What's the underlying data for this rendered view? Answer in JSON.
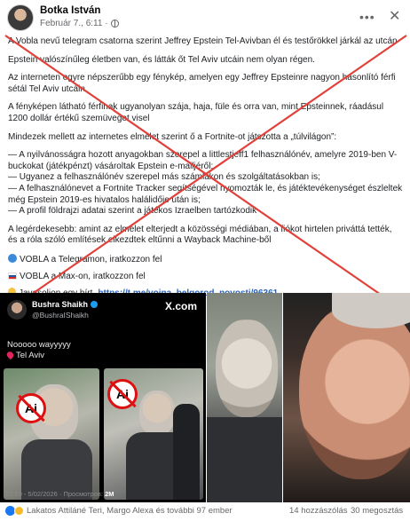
{
  "post": {
    "author": "Botka István",
    "timestamp": "Február 7., 6:11 ·",
    "paragraphs": [
      "A Vobla nevű telegram csatorna szerint Jeffrey Epstein Tel-Avivban él és testőrökkel járkál az utcán",
      "Epstein valószínűleg életben van, és látták őt Tel Aviv utcáin nem olyan régen.",
      "Az interneten egyre népszerűbb egy fénykép, amelyen egy Jeffrey Epsteinre nagyon hasonlító férfi sétál Tel Aviv utcáin",
      "A fényképen látható férfinak ugyanolyan szája, haja, füle és orra van, mint Epsteinnek, ráadásul 1200 dollár értékű szemüveget visel",
      "Mindezek mellett az internetes elmélet szerint ő a Fortnite-ot játszotta a „túlvilágon”:"
    ],
    "bullets": [
      "— A nyilvánosságra hozott anyagokban szerepel a littlestjeff1 felhasználónév, amelyre 2019-ben V-buckokat (játékpénzt) vásároltak Epstein e-mailjéről;",
      "— Ugyanez a felhasználónév szerepel más számlákon és szolgáltatásokban is;",
      "— A felhasználónevet a Fortnite Tracker segítségével nyomozták le, és játéktevékenységet észleltek még Epstein 2019-es hivatalos halálidője után is;",
      "— A profil földrajzi adatai szerint a játékos Izraelben tartózkodik"
    ],
    "closing": "A legérdekesebb: amint az elmélet elterjedt a közösségi médiában, a fiókot hirtelen priváttá tették, és a róla szóló említések elkezdtek eltűnni a Wayback Machine-ből",
    "channel_lines": [
      "VOBLA a Telegramon, iratkozzon fel",
      "VOBLA a Max-on, iratkozzon fel",
      "Javasoljon egy hírt"
    ],
    "channel_link": "https://t.me/voina_belgorod_novosti/96361"
  },
  "tweet": {
    "name": "Bushra Shaikh",
    "handle": "@BushraIShaikh",
    "platform": "X.com",
    "text1": "Nooooo wayyyyy",
    "text2": "Tel Aviv",
    "badge1": "Ai",
    "badge2": "Ai",
    "footer_time": "23:50 - 5/02/2026 · Просмотров:",
    "footer_views": "2M"
  },
  "footer": {
    "reactions_text": "Lakatos Attiláné Teri, Margo Alexa és további 97 ember",
    "comments": "14 hozzászólás",
    "shares": "30 megosztás"
  },
  "icons": {
    "more": "more-options-icon",
    "close": "close-icon",
    "globe": "globe-icon",
    "cross_color": "#e0413a"
  }
}
